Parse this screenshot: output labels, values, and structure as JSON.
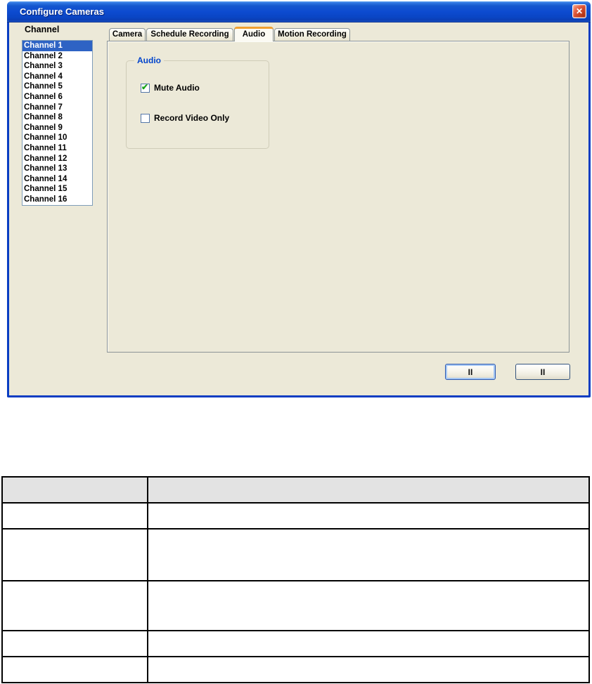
{
  "dialog": {
    "title": "Configure Cameras",
    "close_glyph": "✕",
    "channel_label": "Channel",
    "selected_channel": "Channel 1",
    "channels": [
      "Channel 1",
      "Channel 2",
      "Channel 3",
      "Channel 4",
      "Channel 5",
      "Channel 6",
      "Channel 7",
      "Channel 8",
      "Channel 9",
      "Channel 10",
      "Channel 11",
      "Channel 12",
      "Channel 13",
      "Channel 14",
      "Channel 15",
      "Channel 16"
    ],
    "tabs": [
      {
        "label": "Camera",
        "active": false
      },
      {
        "label": "Schedule Recording",
        "active": false
      },
      {
        "label": "Audio",
        "active": true
      },
      {
        "label": "Motion Recording",
        "active": false
      }
    ],
    "audio_group": {
      "title": "Audio",
      "check_glyph": "✔",
      "options": [
        {
          "label": "Mute Audio",
          "checked": true
        },
        {
          "label": "Record Video Only",
          "checked": false
        }
      ]
    },
    "buttons": [
      {
        "label": "II",
        "focused": true
      },
      {
        "label": "II",
        "focused": false
      }
    ]
  },
  "table": {
    "columns": [
      "",
      ""
    ],
    "rows": [
      [
        "",
        ""
      ],
      [
        "",
        ""
      ],
      [
        "",
        ""
      ],
      [
        "",
        ""
      ],
      [
        "",
        ""
      ]
    ]
  },
  "colors": {
    "titlebar_blue": "#0D4BD0",
    "dialog_border_blue": "#0A3DC2",
    "body_beige": "#ECE9D8",
    "selection_blue": "#2E63C4",
    "tab_active_accent_orange": "#F0A030",
    "group_label_blue": "#0044CC",
    "check_green": "#17A317",
    "close_button_red": "#D1492B",
    "table_header_gray": "#E3E3E3"
  }
}
